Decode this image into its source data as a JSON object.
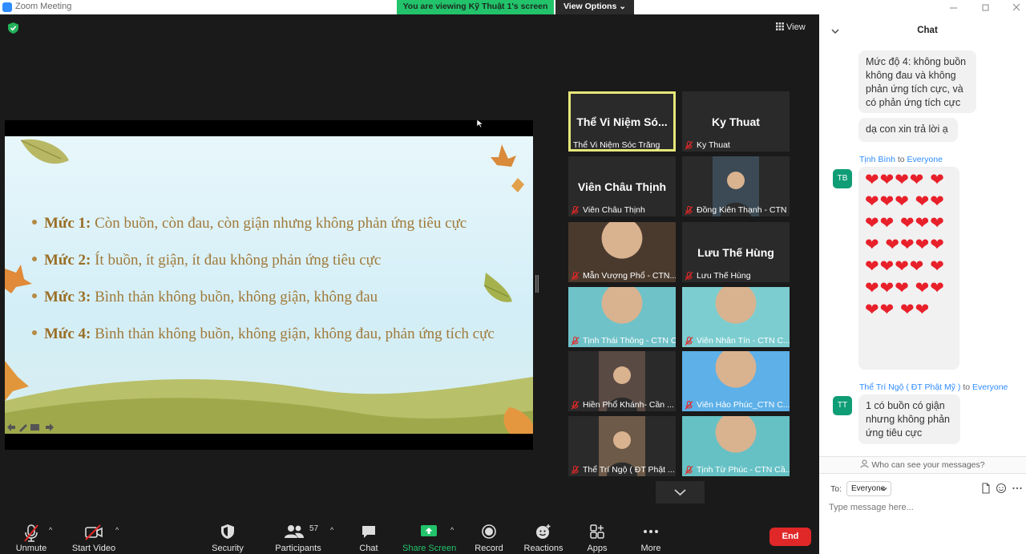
{
  "window": {
    "title": "Zoom Meeting"
  },
  "banner": {
    "viewing": "You are viewing Kỹ Thuật 1's screen",
    "view_options": "View Options ⌄"
  },
  "view_button": "View",
  "slide": {
    "bullets": [
      {
        "level": "Mức 1:",
        "text": " Còn buồn, còn đau, còn giận nhưng không phản ứng tiêu cực"
      },
      {
        "level": "Mức 2:",
        "text": " Ít buồn, ít giận, ít đau không phản ứng tiêu cực"
      },
      {
        "level": "Mức 3:",
        "text": " Bình thản không buồn, không giận, không đau"
      },
      {
        "level": "Mức 4:",
        "text": " Bình thản không buồn, không giận, không đau, phản ứng tích cực"
      }
    ]
  },
  "participants": [
    {
      "big": "Thể Vi Niệm Só...",
      "label": "Thể Vi Niệm Sóc Trăng",
      "active": true,
      "muted": false,
      "video": false
    },
    {
      "big": "Ky Thuat",
      "label": "Ky Thuat",
      "muted": true,
      "video": false
    },
    {
      "big": "Viên Châu Thịnh",
      "label": "Viên Châu Thịnh",
      "muted": true,
      "video": false
    },
    {
      "big": "",
      "label": "Đồng Kiên Thạnh - CTN S...",
      "muted": true,
      "video": true
    },
    {
      "big": "",
      "label": "Mẫn Vượng Phổ - CTN...",
      "muted": true,
      "video": true
    },
    {
      "big": "Lưu Thế Hùng",
      "label": "Lưu Thế Hùng",
      "muted": true,
      "video": false
    },
    {
      "big": "",
      "label": "Tịnh Thái Thông - CTN Cầ...",
      "muted": true,
      "video": true
    },
    {
      "big": "",
      "label": "Viên Nhân Tín - CTN C...",
      "muted": true,
      "video": true
    },
    {
      "big": "",
      "label": "Hiền Phổ Khánh- Cần ...",
      "muted": true,
      "video": true
    },
    {
      "big": "",
      "label": "Viên Hảo Phúc_CTN C...",
      "muted": true,
      "video": true
    },
    {
      "big": "",
      "label": "Thể Trí Ngộ ( ĐT Phật ...",
      "muted": true,
      "video": true
    },
    {
      "big": "",
      "label": "Tịnh Từ Phúc - CTN Cầ...",
      "muted": true,
      "video": true
    }
  ],
  "toolbar": {
    "unmute": "Unmute",
    "start_video": "Start Video",
    "security": "Security",
    "participants": "Participants",
    "participant_count": "57",
    "chat": "Chat",
    "share_screen": "Share Screen",
    "record": "Record",
    "reactions": "Reactions",
    "apps": "Apps",
    "more": "More",
    "end": "End"
  },
  "chat": {
    "title": "Chat",
    "msg1": "Mức độ 4: không buồn không đau và không phản ứng tích cực,  và có phản ứng tích cực",
    "msg2": "dạ con xin trả lời ạ",
    "sender1": {
      "name": "Tịnh Bình",
      "to": " to ",
      "recipient": "Everyone",
      "initials": "TB"
    },
    "hearts": "❤❤❤❤ ❤❤❤❤ ❤❤❤❤ ❤❤❤❤ ❤❤❤❤ ❤❤❤❤ ❤❤❤❤ ❤❤❤❤ ❤❤",
    "sender2": {
      "name": "Thể Trí Ngộ ( ĐT Phật Mỹ )",
      "to": " to ",
      "recipient": "Everyone",
      "initials": "TT"
    },
    "msg3": "1 có buồn có giận nhưng không phản ứng tiêu cực",
    "who_can_see": "Who can see your messages?",
    "to_label": "To:",
    "to_value": "Everyone",
    "placeholder": "Type message here..."
  },
  "colors": {
    "accent": "#2d8cff",
    "banner_green": "#22c36b",
    "end_red": "#e02828",
    "active_tile": "#e6e67a",
    "heart": "#e8202a"
  }
}
